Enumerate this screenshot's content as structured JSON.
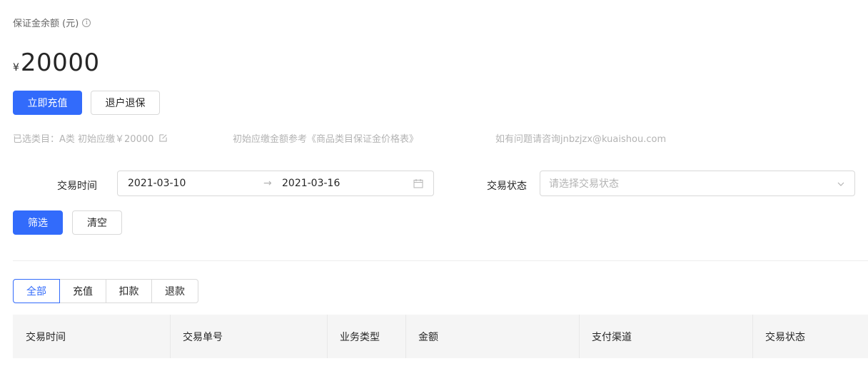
{
  "balance": {
    "label": "保证金余额 (元)",
    "currency": "¥",
    "amount": "20000"
  },
  "actions": {
    "recharge_label": "立即充值",
    "withdraw_label": "退户退保"
  },
  "info": {
    "category_text": "已选类目：A类 初始应缴￥20000",
    "reference_text": "初始应缴金额参考《商品类目保证金价格表》",
    "contact_text": "如有问题请咨询jnbzjzx@kuaishou.com"
  },
  "filters": {
    "time_label": "交易时间",
    "start_date": "2021-03-10",
    "range_separator": "→",
    "end_date": "2021-03-16",
    "status_label": "交易状态",
    "status_placeholder": "请选择交易状态",
    "filter_button": "筛选",
    "clear_button": "清空"
  },
  "tabs": [
    {
      "label": "全部",
      "active": true
    },
    {
      "label": "充值",
      "active": false
    },
    {
      "label": "扣款",
      "active": false
    },
    {
      "label": "退款",
      "active": false
    }
  ],
  "table": {
    "columns": [
      "交易时间",
      "交易单号",
      "业务类型",
      "金额",
      "支付渠道",
      "交易状态"
    ]
  },
  "colors": {
    "primary": "#326bfb",
    "muted_text": "#b3b3b3",
    "header_bg": "#f5f5f5"
  }
}
